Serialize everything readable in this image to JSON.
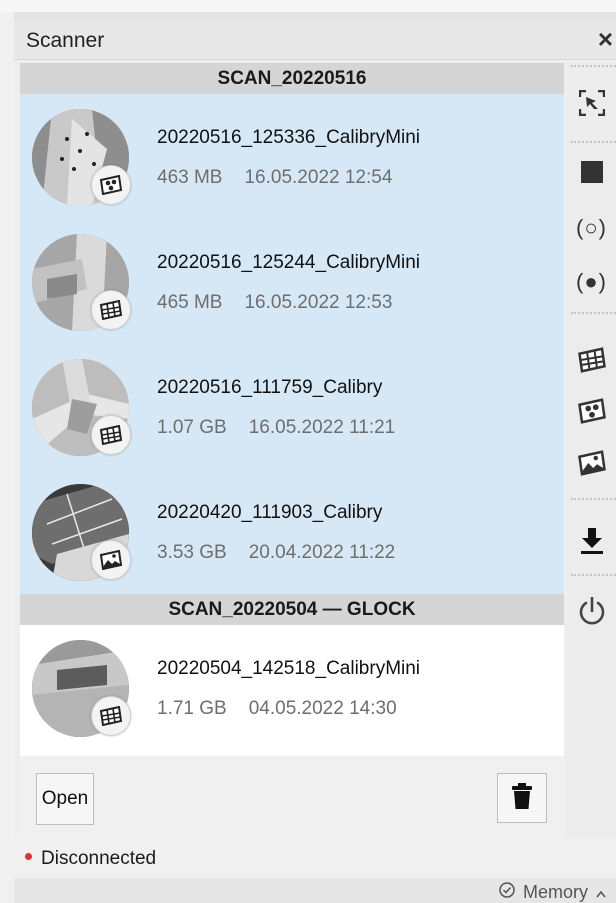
{
  "panel": {
    "title": "Scanner",
    "close_icon": "close-icon"
  },
  "groups": [
    {
      "name": "SCAN_20220516",
      "items": [
        {
          "name": "20220516_125336_CalibryMini",
          "size": "463 MB",
          "date": "16.05.2022 12:54",
          "badge_icon": "texture-icon"
        },
        {
          "name": "20220516_125244_CalibryMini",
          "size": "465 MB",
          "date": "16.05.2022 12:53",
          "badge_icon": "mesh-icon"
        },
        {
          "name": "20220516_111759_Calibry",
          "size": "1.07 GB",
          "date": "16.05.2022 11:21",
          "badge_icon": "mesh-icon"
        },
        {
          "name": "20220420_111903_Calibry",
          "size": "3.53 GB",
          "date": "20.04.2022 11:22",
          "badge_icon": "image-icon"
        }
      ]
    },
    {
      "name": "SCAN_20220504 — GLOCK",
      "items": [
        {
          "name": "20220504_142518_CalibryMini",
          "size": "1.71 GB",
          "date": "04.05.2022 14:30",
          "badge_icon": "mesh-icon"
        }
      ]
    }
  ],
  "footer": {
    "open_label": "Open",
    "trash_icon": "trash-icon"
  },
  "toolbar": {
    "icons": [
      "scan-target-icon",
      "stop-icon",
      "sensor-off-icon",
      "sensor-on-icon",
      "mesh-icon",
      "texture-icon",
      "image-icon",
      "download-icon",
      "power-icon"
    ],
    "sensor_off_glyph": "(○)",
    "sensor_on_glyph": "(●)"
  },
  "status": {
    "text": "Disconnected",
    "color": "#e03030"
  },
  "memory": {
    "label": "Memory",
    "icon": "check-circle-icon"
  },
  "colors": {
    "selected_bg": "#d6e8f6",
    "group_header_bg": "#d5d5d5"
  }
}
